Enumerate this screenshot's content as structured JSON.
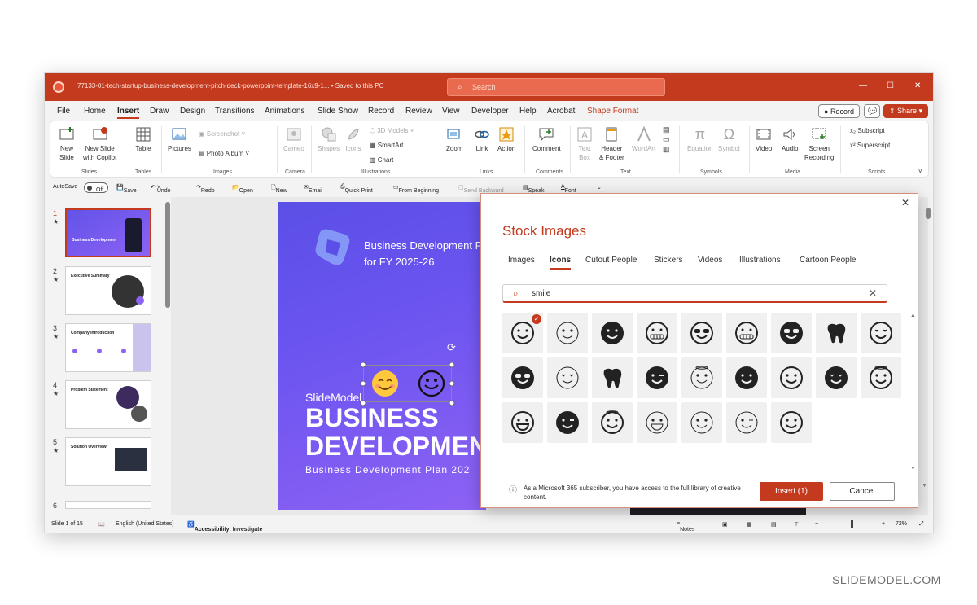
{
  "window": {
    "title": "77133-01-tech-startup-business-development-pitch-deck-powerpoint-template-16x9-1...  •  Saved to this PC",
    "search_placeholder": "Search"
  },
  "tabs": [
    "File",
    "Home",
    "Insert",
    "Draw",
    "Design",
    "Transitions",
    "Animations",
    "Slide Show",
    "Record",
    "Review",
    "View",
    "Developer",
    "Help",
    "Acrobat",
    "Shape Format"
  ],
  "header_buttons": {
    "record": "Record",
    "share": "Share"
  },
  "ribbon": {
    "new_slide": "New\nSlide",
    "new_slide_copilot": "New Slide\nwith Copilot",
    "table": "Table",
    "pictures": "Pictures",
    "screenshot": "Screenshot",
    "photo_album": "Photo Album",
    "cameo": "Cameo",
    "shapes": "Shapes",
    "icons": "Icons",
    "models_3d": "3D Models",
    "smartart": "SmartArt",
    "chart": "Chart",
    "zoom": "Zoom",
    "link": "Link",
    "action": "Action",
    "comment": "Comment",
    "text_box": "Text\nBox",
    "header_footer": "Header\n& Footer",
    "wordart": "WordArt",
    "equation": "Equation",
    "symbol": "Symbol",
    "video": "Video",
    "audio": "Audio",
    "screen_recording": "Screen\nRecording",
    "subscript": "Subscript",
    "superscript": "Superscript",
    "groups": [
      "Slides",
      "Tables",
      "Images",
      "Camera",
      "Illustrations",
      "Links",
      "Comments",
      "Text",
      "Symbols",
      "Media",
      "Scripts"
    ]
  },
  "quick_access": {
    "autosave": "AutoSave",
    "toggle": "Off",
    "save": "Save",
    "undo": "Undo",
    "redo": "Redo",
    "new": "New",
    "open": "Open",
    "email": "Email",
    "quick_print": "Quick Print",
    "from_beginning": "From Beginning",
    "send_backward": "Send Backward",
    "speak": "Speak",
    "font": "Font"
  },
  "slides_panel": {
    "numbers": [
      "1",
      "2",
      "3",
      "4",
      "5",
      "6"
    ],
    "thumb_titles": [
      "Business Development",
      "Executive Summary",
      "Company Introduction",
      "Problem Statement",
      "Solution Overview"
    ]
  },
  "slide": {
    "subtitle_line1": "Business Development P",
    "subtitle_line2": "for FY 2025-26",
    "brand": "SlideModel",
    "heading_line1": "BUSINESS",
    "heading_line2": "DEVELOPMEN",
    "plan": "Business Development Plan 202"
  },
  "status_bar": {
    "slide_count": "Slide 1 of 15",
    "language": "English (United States)",
    "accessibility": "Accessibility: Investigate",
    "notes": "Notes",
    "zoom": "72%"
  },
  "dialog": {
    "title": "Stock Images",
    "tabs": [
      "Images",
      "Icons",
      "Cutout People",
      "Stickers",
      "Videos",
      "Illustrations",
      "Cartoon People"
    ],
    "search_value": "smile",
    "info": "As a Microsoft 365 subscriber, you have access to the full library of creative content.",
    "insert": "Insert (1)",
    "cancel": "Cancel"
  },
  "watermark": "SLIDEMODEL.COM",
  "colors": {
    "accent": "#c33a1f",
    "slide_bg": "#6b54f0"
  }
}
